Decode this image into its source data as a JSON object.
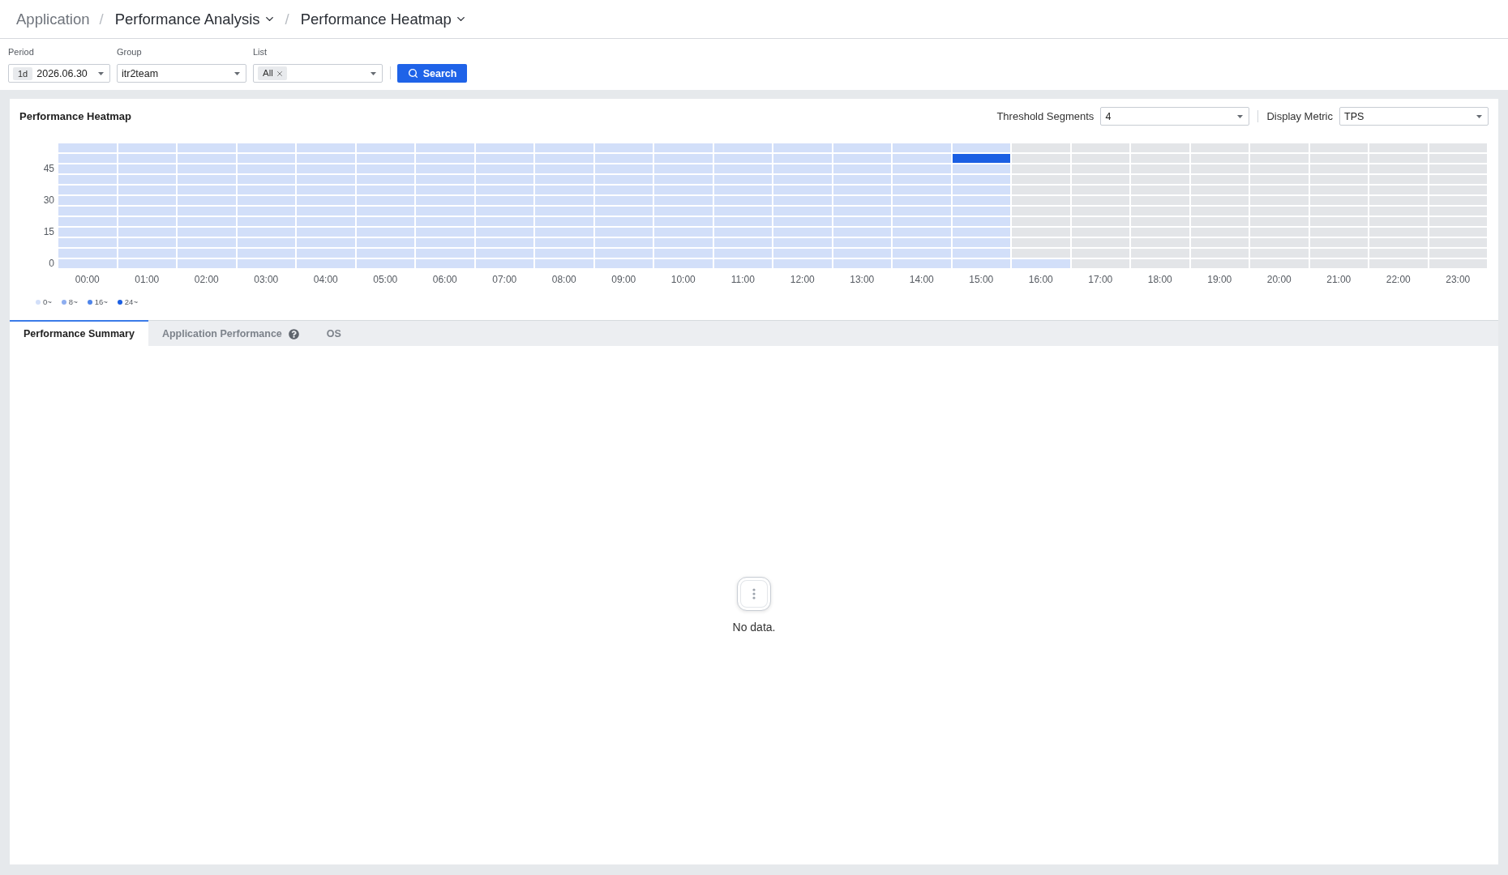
{
  "breadcrumb": [
    {
      "label": "Application",
      "kind": "link"
    },
    {
      "label": "Performance Analysis",
      "kind": "menu",
      "separator": "/"
    },
    {
      "label": "Performance Heatmap",
      "kind": "menu",
      "separator": "/"
    }
  ],
  "filters": {
    "period": {
      "label": "Period",
      "badge": "1d",
      "value": "2026.06.30"
    },
    "group": {
      "label": "Group",
      "value": "itr2team"
    },
    "list": {
      "label": "List",
      "tags": [
        "All"
      ]
    },
    "search_button": "Search"
  },
  "heatmap": {
    "title": "Performance Heatmap",
    "controls": [
      {
        "label": "Threshold Segments",
        "value": "4"
      },
      {
        "label": "Display Metric",
        "value": "TPS"
      }
    ],
    "rows": [
      {
        "cells": [
          {
            "color": "#d2dff9"
          },
          {
            "color": "#d2dff9"
          },
          {
            "color": "#d2dff9"
          },
          {
            "color": "#d2dff9"
          },
          {
            "color": "#d2dff9"
          },
          {
            "color": "#d2dff9"
          },
          {
            "color": "#d2dff9"
          },
          {
            "color": "#d2dff9"
          },
          {
            "color": "#d2dff9"
          },
          {
            "color": "#d2dff9"
          },
          {
            "color": "#d2dff9"
          },
          {
            "color": "#d2dff9"
          },
          {
            "color": "#d2dff9"
          },
          {
            "color": "#d2dff9"
          },
          {
            "color": "#d2dff9"
          },
          {
            "color": "#d2dff9"
          },
          {
            "color": "#e3e5e8"
          },
          {
            "color": "#e3e5e8"
          },
          {
            "color": "#e3e5e8"
          },
          {
            "color": "#e3e5e8"
          },
          {
            "color": "#e3e5e8"
          },
          {
            "color": "#e3e5e8"
          },
          {
            "color": "#e3e5e8"
          },
          {
            "color": "#e3e5e8"
          }
        ]
      },
      {
        "cells": [
          {
            "color": "#d2dff9"
          },
          {
            "color": "#d2dff9"
          },
          {
            "color": "#d2dff9"
          },
          {
            "color": "#d2dff9"
          },
          {
            "color": "#d2dff9"
          },
          {
            "color": "#d2dff9"
          },
          {
            "color": "#d2dff9"
          },
          {
            "color": "#d2dff9"
          },
          {
            "color": "#d2dff9"
          },
          {
            "color": "#d2dff9"
          },
          {
            "color": "#d2dff9"
          },
          {
            "color": "#d2dff9"
          },
          {
            "color": "#d2dff9"
          },
          {
            "color": "#d2dff9"
          },
          {
            "color": "#d2dff9"
          },
          {
            "color": "#1b5fe3"
          },
          {
            "color": "#e3e5e8"
          },
          {
            "color": "#e3e5e8"
          },
          {
            "color": "#e3e5e8"
          },
          {
            "color": "#e3e5e8"
          },
          {
            "color": "#e3e5e8"
          },
          {
            "color": "#e3e5e8"
          },
          {
            "color": "#e3e5e8"
          },
          {
            "color": "#e3e5e8"
          }
        ]
      },
      {
        "y_label": "45",
        "cells": [
          {
            "color": "#d2dff9"
          },
          {
            "color": "#d2dff9"
          },
          {
            "color": "#d2dff9"
          },
          {
            "color": "#d2dff9"
          },
          {
            "color": "#d2dff9"
          },
          {
            "color": "#d2dff9"
          },
          {
            "color": "#d2dff9"
          },
          {
            "color": "#d2dff9"
          },
          {
            "color": "#d2dff9"
          },
          {
            "color": "#d2dff9"
          },
          {
            "color": "#d2dff9"
          },
          {
            "color": "#d2dff9"
          },
          {
            "color": "#d2dff9"
          },
          {
            "color": "#d2dff9"
          },
          {
            "color": "#d2dff9"
          },
          {
            "color": "#d2dff9"
          },
          {
            "color": "#e3e5e8"
          },
          {
            "color": "#e3e5e8"
          },
          {
            "color": "#e3e5e8"
          },
          {
            "color": "#e3e5e8"
          },
          {
            "color": "#e3e5e8"
          },
          {
            "color": "#e3e5e8"
          },
          {
            "color": "#e3e5e8"
          },
          {
            "color": "#e3e5e8"
          }
        ]
      },
      {
        "cells": [
          {
            "color": "#d2dff9"
          },
          {
            "color": "#d2dff9"
          },
          {
            "color": "#d2dff9"
          },
          {
            "color": "#d2dff9"
          },
          {
            "color": "#d2dff9"
          },
          {
            "color": "#d2dff9"
          },
          {
            "color": "#d2dff9"
          },
          {
            "color": "#d2dff9"
          },
          {
            "color": "#d2dff9"
          },
          {
            "color": "#d2dff9"
          },
          {
            "color": "#d2dff9"
          },
          {
            "color": "#d2dff9"
          },
          {
            "color": "#d2dff9"
          },
          {
            "color": "#d2dff9"
          },
          {
            "color": "#d2dff9"
          },
          {
            "color": "#d2dff9"
          },
          {
            "color": "#e3e5e8"
          },
          {
            "color": "#e3e5e8"
          },
          {
            "color": "#e3e5e8"
          },
          {
            "color": "#e3e5e8"
          },
          {
            "color": "#e3e5e8"
          },
          {
            "color": "#e3e5e8"
          },
          {
            "color": "#e3e5e8"
          },
          {
            "color": "#e3e5e8"
          }
        ]
      },
      {
        "cells": [
          {
            "color": "#d2dff9"
          },
          {
            "color": "#d2dff9"
          },
          {
            "color": "#d2dff9"
          },
          {
            "color": "#d2dff9"
          },
          {
            "color": "#d2dff9"
          },
          {
            "color": "#d2dff9"
          },
          {
            "color": "#d2dff9"
          },
          {
            "color": "#d2dff9"
          },
          {
            "color": "#d2dff9"
          },
          {
            "color": "#d2dff9"
          },
          {
            "color": "#d2dff9"
          },
          {
            "color": "#d2dff9"
          },
          {
            "color": "#d2dff9"
          },
          {
            "color": "#d2dff9"
          },
          {
            "color": "#d2dff9"
          },
          {
            "color": "#d2dff9"
          },
          {
            "color": "#e3e5e8"
          },
          {
            "color": "#e3e5e8"
          },
          {
            "color": "#e3e5e8"
          },
          {
            "color": "#e3e5e8"
          },
          {
            "color": "#e3e5e8"
          },
          {
            "color": "#e3e5e8"
          },
          {
            "color": "#e3e5e8"
          },
          {
            "color": "#e3e5e8"
          }
        ]
      },
      {
        "y_label": "30",
        "cells": [
          {
            "color": "#d2dff9"
          },
          {
            "color": "#d2dff9"
          },
          {
            "color": "#d2dff9"
          },
          {
            "color": "#d2dff9"
          },
          {
            "color": "#d2dff9"
          },
          {
            "color": "#d2dff9"
          },
          {
            "color": "#d2dff9"
          },
          {
            "color": "#d2dff9"
          },
          {
            "color": "#d2dff9"
          },
          {
            "color": "#d2dff9"
          },
          {
            "color": "#d2dff9"
          },
          {
            "color": "#d2dff9"
          },
          {
            "color": "#d2dff9"
          },
          {
            "color": "#d2dff9"
          },
          {
            "color": "#d2dff9"
          },
          {
            "color": "#d2dff9"
          },
          {
            "color": "#e3e5e8"
          },
          {
            "color": "#e3e5e8"
          },
          {
            "color": "#e3e5e8"
          },
          {
            "color": "#e3e5e8"
          },
          {
            "color": "#e3e5e8"
          },
          {
            "color": "#e3e5e8"
          },
          {
            "color": "#e3e5e8"
          },
          {
            "color": "#e3e5e8"
          }
        ]
      },
      {
        "cells": [
          {
            "color": "#d2dff9"
          },
          {
            "color": "#d2dff9"
          },
          {
            "color": "#d2dff9"
          },
          {
            "color": "#d2dff9"
          },
          {
            "color": "#d2dff9"
          },
          {
            "color": "#d2dff9"
          },
          {
            "color": "#d2dff9"
          },
          {
            "color": "#d2dff9"
          },
          {
            "color": "#d2dff9"
          },
          {
            "color": "#d2dff9"
          },
          {
            "color": "#d2dff9"
          },
          {
            "color": "#d2dff9"
          },
          {
            "color": "#d2dff9"
          },
          {
            "color": "#d2dff9"
          },
          {
            "color": "#d2dff9"
          },
          {
            "color": "#d2dff9"
          },
          {
            "color": "#e3e5e8"
          },
          {
            "color": "#e3e5e8"
          },
          {
            "color": "#e3e5e8"
          },
          {
            "color": "#e3e5e8"
          },
          {
            "color": "#e3e5e8"
          },
          {
            "color": "#e3e5e8"
          },
          {
            "color": "#e3e5e8"
          },
          {
            "color": "#e3e5e8"
          }
        ]
      },
      {
        "cells": [
          {
            "color": "#d2dff9"
          },
          {
            "color": "#d2dff9"
          },
          {
            "color": "#d2dff9"
          },
          {
            "color": "#d2dff9"
          },
          {
            "color": "#d2dff9"
          },
          {
            "color": "#d2dff9"
          },
          {
            "color": "#d2dff9"
          },
          {
            "color": "#d2dff9"
          },
          {
            "color": "#d2dff9"
          },
          {
            "color": "#d2dff9"
          },
          {
            "color": "#d2dff9"
          },
          {
            "color": "#d2dff9"
          },
          {
            "color": "#d2dff9"
          },
          {
            "color": "#d2dff9"
          },
          {
            "color": "#d2dff9"
          },
          {
            "color": "#d2dff9"
          },
          {
            "color": "#e3e5e8"
          },
          {
            "color": "#e3e5e8"
          },
          {
            "color": "#e3e5e8"
          },
          {
            "color": "#e3e5e8"
          },
          {
            "color": "#e3e5e8"
          },
          {
            "color": "#e3e5e8"
          },
          {
            "color": "#e3e5e8"
          },
          {
            "color": "#e3e5e8"
          }
        ]
      },
      {
        "y_label": "15",
        "cells": [
          {
            "color": "#d2dff9"
          },
          {
            "color": "#d2dff9"
          },
          {
            "color": "#d2dff9"
          },
          {
            "color": "#d2dff9"
          },
          {
            "color": "#d2dff9"
          },
          {
            "color": "#d2dff9"
          },
          {
            "color": "#d2dff9"
          },
          {
            "color": "#d2dff9"
          },
          {
            "color": "#d2dff9"
          },
          {
            "color": "#d2dff9"
          },
          {
            "color": "#d2dff9"
          },
          {
            "color": "#d2dff9"
          },
          {
            "color": "#d2dff9"
          },
          {
            "color": "#d2dff9"
          },
          {
            "color": "#d2dff9"
          },
          {
            "color": "#d2dff9"
          },
          {
            "color": "#e3e5e8"
          },
          {
            "color": "#e3e5e8"
          },
          {
            "color": "#e3e5e8"
          },
          {
            "color": "#e3e5e8"
          },
          {
            "color": "#e3e5e8"
          },
          {
            "color": "#e3e5e8"
          },
          {
            "color": "#e3e5e8"
          },
          {
            "color": "#e3e5e8"
          }
        ]
      },
      {
        "cells": [
          {
            "color": "#d2dff9"
          },
          {
            "color": "#d2dff9"
          },
          {
            "color": "#d2dff9"
          },
          {
            "color": "#d2dff9"
          },
          {
            "color": "#d2dff9"
          },
          {
            "color": "#d2dff9"
          },
          {
            "color": "#d2dff9"
          },
          {
            "color": "#d2dff9"
          },
          {
            "color": "#d2dff9"
          },
          {
            "color": "#d2dff9"
          },
          {
            "color": "#d2dff9"
          },
          {
            "color": "#d2dff9"
          },
          {
            "color": "#d2dff9"
          },
          {
            "color": "#d2dff9"
          },
          {
            "color": "#d2dff9"
          },
          {
            "color": "#d2dff9"
          },
          {
            "color": "#e3e5e8"
          },
          {
            "color": "#e3e5e8"
          },
          {
            "color": "#e3e5e8"
          },
          {
            "color": "#e3e5e8"
          },
          {
            "color": "#e3e5e8"
          },
          {
            "color": "#e3e5e8"
          },
          {
            "color": "#e3e5e8"
          },
          {
            "color": "#e3e5e8"
          }
        ]
      },
      {
        "cells": [
          {
            "color": "#d2dff9"
          },
          {
            "color": "#d2dff9"
          },
          {
            "color": "#d2dff9"
          },
          {
            "color": "#d2dff9"
          },
          {
            "color": "#d2dff9"
          },
          {
            "color": "#d2dff9"
          },
          {
            "color": "#d2dff9"
          },
          {
            "color": "#d2dff9"
          },
          {
            "color": "#d2dff9"
          },
          {
            "color": "#d2dff9"
          },
          {
            "color": "#d2dff9"
          },
          {
            "color": "#d2dff9"
          },
          {
            "color": "#d2dff9"
          },
          {
            "color": "#d2dff9"
          },
          {
            "color": "#d2dff9"
          },
          {
            "color": "#d2dff9"
          },
          {
            "color": "#e3e5e8"
          },
          {
            "color": "#e3e5e8"
          },
          {
            "color": "#e3e5e8"
          },
          {
            "color": "#e3e5e8"
          },
          {
            "color": "#e3e5e8"
          },
          {
            "color": "#e3e5e8"
          },
          {
            "color": "#e3e5e8"
          },
          {
            "color": "#e3e5e8"
          }
        ]
      },
      {
        "y_label": "0",
        "cells": [
          {
            "color": "#d2dff9"
          },
          {
            "color": "#d2dff9"
          },
          {
            "color": "#d2dff9"
          },
          {
            "color": "#d2dff9"
          },
          {
            "color": "#d2dff9"
          },
          {
            "color": "#d2dff9"
          },
          {
            "color": "#d2dff9"
          },
          {
            "color": "#d2dff9"
          },
          {
            "color": "#d2dff9"
          },
          {
            "color": "#d2dff9"
          },
          {
            "color": "#d2dff9"
          },
          {
            "color": "#d2dff9"
          },
          {
            "color": "#d2dff9"
          },
          {
            "color": "#d2dff9"
          },
          {
            "color": "#d2dff9"
          },
          {
            "color": "#d2dff9"
          },
          {
            "color": "#d2dff9"
          },
          {
            "color": "#e3e5e8"
          },
          {
            "color": "#e3e5e8"
          },
          {
            "color": "#e3e5e8"
          },
          {
            "color": "#e3e5e8"
          },
          {
            "color": "#e3e5e8"
          },
          {
            "color": "#e3e5e8"
          },
          {
            "color": "#e3e5e8"
          }
        ]
      }
    ],
    "x_labels": [
      "00:00",
      "01:00",
      "02:00",
      "03:00",
      "04:00",
      "05:00",
      "06:00",
      "07:00",
      "08:00",
      "09:00",
      "10:00",
      "11:00",
      "12:00",
      "13:00",
      "14:00",
      "15:00",
      "16:00",
      "17:00",
      "18:00",
      "19:00",
      "20:00",
      "21:00",
      "22:00",
      "23:00"
    ],
    "legend": [
      {
        "label": "0~",
        "color": "#d2dff9"
      },
      {
        "label": "8~",
        "color": "#8eaef0"
      },
      {
        "label": "16~",
        "color": "#4f85ea"
      },
      {
        "label": "24~",
        "color": "#1b5fe3"
      }
    ]
  },
  "tabs": [
    {
      "label": "Performance Summary",
      "selected": true,
      "help": false
    },
    {
      "label": "Application Performance",
      "selected": false,
      "help": true
    },
    {
      "label": "OS",
      "selected": false,
      "help": false
    }
  ],
  "empty_state": {
    "message": "No data."
  }
}
